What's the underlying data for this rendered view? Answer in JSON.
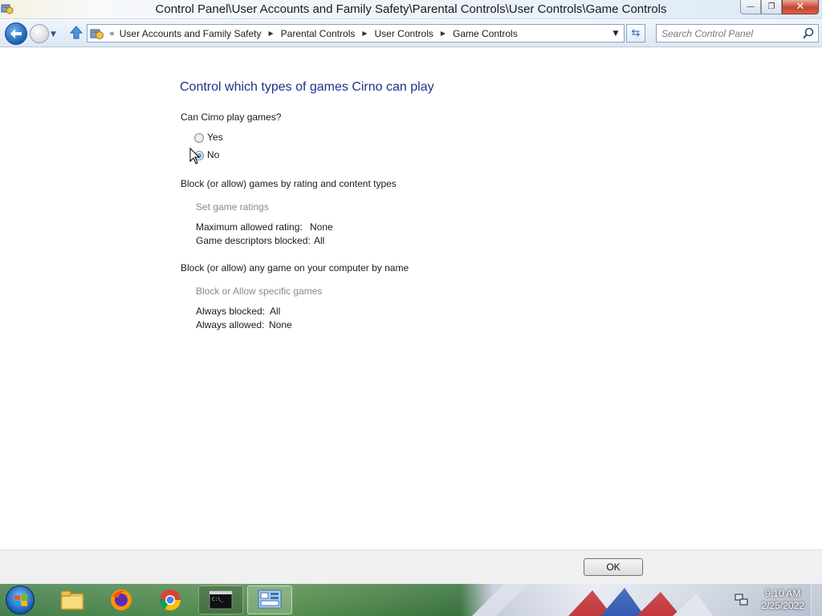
{
  "window": {
    "title": "Control Panel\\User Accounts and Family Safety\\Parental Controls\\User Controls\\Game Controls",
    "controls": {
      "minimize": "—",
      "maximize": "❐",
      "close": "✕"
    }
  },
  "navbar": {
    "overflow_chevron": "«",
    "breadcrumbs": [
      "User Accounts and Family Safety",
      "Parental Controls",
      "User Controls",
      "Game Controls"
    ],
    "search_placeholder": "Search Control Panel"
  },
  "main": {
    "title": "Control which types of games Cirno can play",
    "question": "Can Cirno play games?",
    "options": [
      {
        "label": "Yes",
        "selected": false
      },
      {
        "label": "No",
        "selected": true
      }
    ],
    "rating_section": {
      "heading": "Block (or allow) games by rating and content types",
      "link": "Set game ratings",
      "max_rating_label": "Maximum allowed rating:",
      "max_rating_value": "None",
      "descriptors_label": "Game descriptors blocked:",
      "descriptors_value": "All"
    },
    "name_section": {
      "heading": "Block (or allow) any game on your computer by name",
      "link": "Block or Allow specific games",
      "blocked_label": "Always blocked:",
      "blocked_value": "All",
      "allowed_label": "Always allowed:",
      "allowed_value": "None"
    }
  },
  "footer": {
    "ok_label": "OK"
  },
  "taskbar": {
    "apps": [
      "windows-explorer",
      "firefox",
      "chrome",
      "command-prompt",
      "control-panel"
    ],
    "clock": {
      "time": "9:10 AM",
      "date": "2/25/2022"
    }
  },
  "colors": {
    "title_blue": "#1e3287",
    "disabled_link": "#8a8a8a",
    "radio_selected": "#1a6fc4"
  }
}
